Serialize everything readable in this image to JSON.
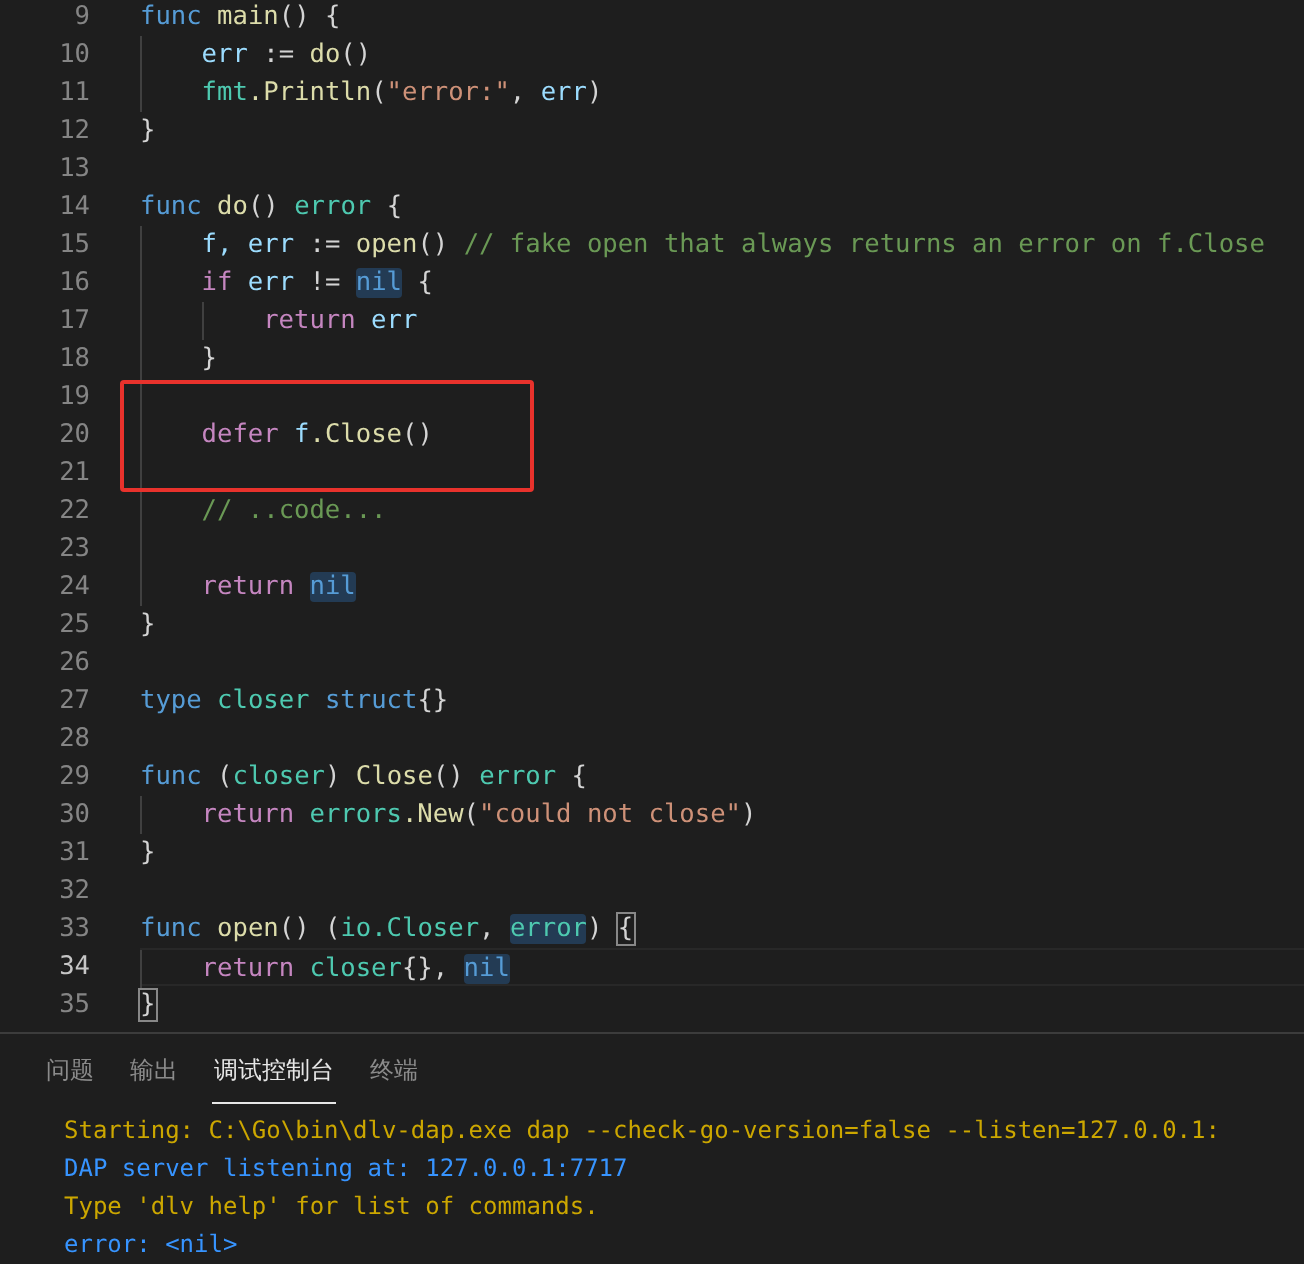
{
  "editor": {
    "lines": [
      {
        "number": "9",
        "tokens": [
          {
            "kind": "kw",
            "text": "func"
          },
          {
            "kind": "fn",
            "text": " main"
          },
          {
            "kind": "plain",
            "text": "() {"
          }
        ]
      },
      {
        "number": "10",
        "tokens": [
          {
            "kind": "var",
            "text": "    err"
          },
          {
            "kind": "plain",
            "text": " := "
          },
          {
            "kind": "fn",
            "text": "do"
          },
          {
            "kind": "plain",
            "text": "()"
          }
        ]
      },
      {
        "number": "11",
        "tokens": [
          {
            "kind": "type",
            "text": "    fmt"
          },
          {
            "kind": "fn",
            "text": ".Println"
          },
          {
            "kind": "plain",
            "text": "("
          },
          {
            "kind": "str",
            "text": "\"error:\""
          },
          {
            "kind": "plain",
            "text": ", "
          },
          {
            "kind": "var",
            "text": "err"
          },
          {
            "kind": "plain",
            "text": ")"
          }
        ]
      },
      {
        "number": "12",
        "tokens": [
          {
            "kind": "plain",
            "text": "}"
          }
        ]
      },
      {
        "number": "13"
      },
      {
        "number": "14",
        "tokens": [
          {
            "kind": "kw",
            "text": "func"
          },
          {
            "kind": "fn",
            "text": " do"
          },
          {
            "kind": "plain",
            "text": "() "
          },
          {
            "kind": "type",
            "text": "error"
          },
          {
            "kind": "plain",
            "text": " {"
          }
        ]
      },
      {
        "number": "15",
        "tokens": [
          {
            "kind": "var",
            "text": "    f, err"
          },
          {
            "kind": "plain",
            "text": " := "
          },
          {
            "kind": "fn",
            "text": "open"
          },
          {
            "kind": "plain",
            "text": "() "
          },
          {
            "kind": "com",
            "text": "// fake open that always returns an error on f.Close"
          }
        ]
      },
      {
        "number": "16",
        "tokens": [
          {
            "kind": "ctrl",
            "text": "    if"
          },
          {
            "kind": "var",
            "text": " err"
          },
          {
            "kind": "plain",
            "text": " != "
          },
          {
            "kind": "kw",
            "text": "nil",
            "highlighted": true
          },
          {
            "kind": "plain",
            "text": " {"
          }
        ]
      },
      {
        "number": "17",
        "tokens": [
          {
            "kind": "ctrl",
            "text": "        return"
          },
          {
            "kind": "var",
            "text": " err"
          }
        ]
      },
      {
        "number": "18",
        "tokens": [
          {
            "kind": "plain",
            "text": "    }"
          }
        ]
      },
      {
        "number": "19",
        "in_callout": true,
        "indent_guide": true
      },
      {
        "number": "20",
        "in_callout": true,
        "tokens": [
          {
            "kind": "ctrl",
            "text": "    defer"
          },
          {
            "kind": "var",
            "text": " f"
          },
          {
            "kind": "fn",
            "text": ".Close"
          },
          {
            "kind": "plain",
            "text": "()"
          }
        ]
      },
      {
        "number": "21",
        "in_callout": true,
        "indent_guide": true
      },
      {
        "number": "22",
        "tokens": [
          {
            "kind": "com",
            "text": "    // ..code..."
          }
        ]
      },
      {
        "number": "23",
        "indent_guide": true
      },
      {
        "number": "24",
        "tokens": [
          {
            "kind": "ctrl",
            "text": "    return "
          },
          {
            "kind": "kw",
            "text": "nil",
            "highlighted": true
          }
        ]
      },
      {
        "number": "25",
        "tokens": [
          {
            "kind": "plain",
            "text": "}"
          }
        ]
      },
      {
        "number": "26"
      },
      {
        "number": "27",
        "tokens": [
          {
            "kind": "kw",
            "text": "type"
          },
          {
            "kind": "type",
            "text": " closer"
          },
          {
            "kind": "kw",
            "text": " struct"
          },
          {
            "kind": "plain",
            "text": "{}"
          }
        ]
      },
      {
        "number": "28"
      },
      {
        "number": "29",
        "tokens": [
          {
            "kind": "kw",
            "text": "func"
          },
          {
            "kind": "plain",
            "text": " ("
          },
          {
            "kind": "type",
            "text": "closer"
          },
          {
            "kind": "plain",
            "text": ") "
          },
          {
            "kind": "fn",
            "text": "Close"
          },
          {
            "kind": "plain",
            "text": "() "
          },
          {
            "kind": "type",
            "text": "error"
          },
          {
            "kind": "plain",
            "text": " {"
          }
        ]
      },
      {
        "number": "30",
        "tokens": [
          {
            "kind": "ctrl",
            "text": "    return"
          },
          {
            "kind": "type",
            "text": " errors"
          },
          {
            "kind": "fn",
            "text": ".New"
          },
          {
            "kind": "plain",
            "text": "("
          },
          {
            "kind": "str",
            "text": "\"could not close\""
          },
          {
            "kind": "plain",
            "text": ")"
          }
        ]
      },
      {
        "number": "31",
        "tokens": [
          {
            "kind": "plain",
            "text": "}"
          }
        ]
      },
      {
        "number": "32"
      },
      {
        "number": "33",
        "tokens": [
          {
            "kind": "kw",
            "text": "func"
          },
          {
            "kind": "fn",
            "text": " open"
          },
          {
            "kind": "plain",
            "text": "() ("
          },
          {
            "kind": "type",
            "text": "io.Closer"
          },
          {
            "kind": "plain",
            "text": ", "
          },
          {
            "kind": "type",
            "text": "error",
            "highlighted": true
          },
          {
            "kind": "plain",
            "text": ") "
          },
          {
            "kind": "plain",
            "text": "{",
            "bracket_match": true
          }
        ]
      },
      {
        "number": "34",
        "current": true,
        "tokens": [
          {
            "kind": "ctrl",
            "text": "    return"
          },
          {
            "kind": "type",
            "text": " closer"
          },
          {
            "kind": "plain",
            "text": "{}, "
          },
          {
            "kind": "kw",
            "text": "nil",
            "highlighted": true
          }
        ]
      },
      {
        "number": "35",
        "tokens": [
          {
            "kind": "plain",
            "text": "}",
            "bracket_match": true
          }
        ]
      }
    ]
  },
  "panel": {
    "tabs": [
      {
        "label": "问题",
        "selected": false
      },
      {
        "label": "输出",
        "selected": false
      },
      {
        "label": "调试控制台",
        "selected": true
      },
      {
        "label": "终端",
        "selected": false
      }
    ],
    "output": [
      {
        "kind": "info",
        "text": "Starting: C:\\Go\\bin\\dlv-dap.exe dap --check-go-version=false --listen=127.0.0.1:"
      },
      {
        "kind": "log",
        "text": "DAP server listening at: 127.0.0.1:7717"
      },
      {
        "kind": "info",
        "text": "Type 'dlv help' for list of commands."
      },
      {
        "kind": "log",
        "text": "error: <nil>"
      }
    ]
  }
}
